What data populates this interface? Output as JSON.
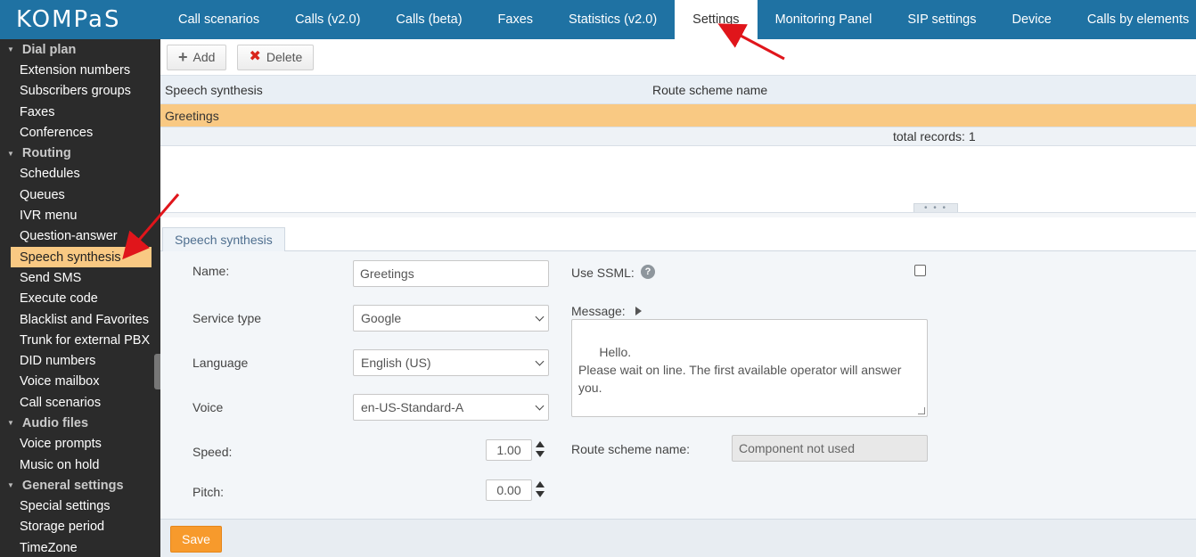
{
  "app": {
    "logo": "KOMPaS"
  },
  "nav": {
    "tabs": [
      {
        "label": "Call scenarios"
      },
      {
        "label": "Calls (v2.0)"
      },
      {
        "label": "Calls (beta)"
      },
      {
        "label": "Faxes"
      },
      {
        "label": "Statistics (v2.0)"
      },
      {
        "label": "Settings",
        "active": true
      },
      {
        "label": "Monitoring Panel"
      },
      {
        "label": "SIP settings"
      },
      {
        "label": "Device"
      },
      {
        "label": "Calls by elements"
      }
    ]
  },
  "sidebar": {
    "groups": [
      {
        "label": "Dial plan",
        "items": [
          "Extension numbers",
          "Subscribers groups",
          "Faxes",
          "Conferences"
        ]
      },
      {
        "label": "Routing",
        "items": [
          "Schedules",
          "Queues",
          "IVR menu",
          "Question-answer",
          "Speech synthesis",
          "Send SMS",
          "Execute code",
          "Blacklist and Favorites",
          "Trunk for external PBX",
          "DID numbers",
          "Voice mailbox",
          "Call scenarios"
        ]
      },
      {
        "label": "Audio files",
        "items": [
          "Voice prompts",
          "Music on hold"
        ]
      },
      {
        "label": "General settings",
        "items": [
          "Special settings",
          "Storage period",
          "TimeZone"
        ]
      }
    ],
    "active_item": "Speech synthesis"
  },
  "toolbar": {
    "add_label": "Add",
    "delete_label": "Delete"
  },
  "grid": {
    "columns": [
      "Speech synthesis",
      "Route scheme name"
    ],
    "rows": [
      [
        "Greetings",
        ""
      ]
    ],
    "footer": "total records: 1"
  },
  "form": {
    "tab_label": "Speech synthesis",
    "name_label": "Name:",
    "name_value": "Greetings",
    "service_type_label": "Service type",
    "service_type_value": "Google",
    "language_label": "Language",
    "language_value": "English (US)",
    "voice_label": "Voice",
    "voice_value": "en-US-Standard-A",
    "speed_label": "Speed:",
    "speed_value": "1.00",
    "pitch_label": "Pitch:",
    "pitch_value": "0.00",
    "ssml_label": "Use SSML:",
    "ssml_help": "?",
    "ssml_checked": false,
    "message_label": "Message:",
    "message_value": "Hello.\nPlease wait on line. The first available operator will answer you.",
    "route_scheme_label": "Route scheme name:",
    "route_scheme_value": "Component not used",
    "save_label": "Save"
  },
  "colors": {
    "topbar": "#1f72a3",
    "sidebar": "#2b2b2b",
    "highlight": "#f9c983",
    "save_button": "#f79a2c",
    "annotation_arrow": "#e0151b"
  }
}
